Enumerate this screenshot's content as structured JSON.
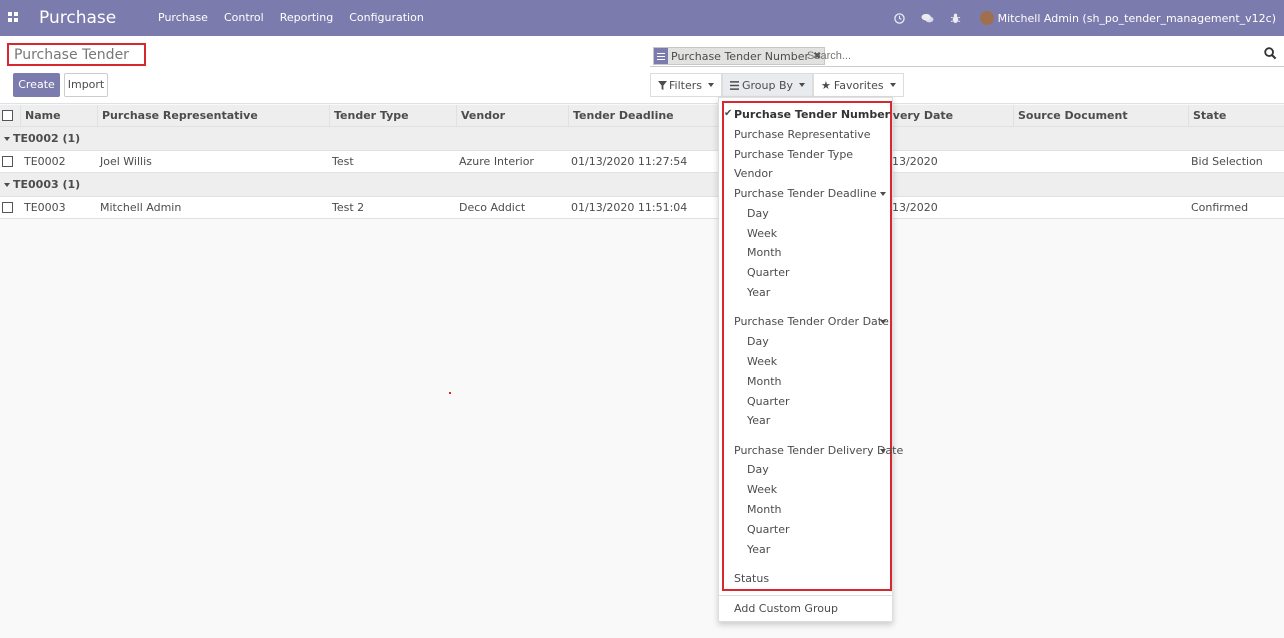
{
  "navbar": {
    "brand": "Purchase",
    "menu": [
      "Purchase",
      "Control",
      "Reporting",
      "Configuration"
    ],
    "user": "Mitchell Admin (sh_po_tender_management_v12c)",
    "icons": [
      "clock-icon",
      "chat-icon",
      "bug-icon"
    ]
  },
  "breadcrumb": "Purchase Tender",
  "buttons": {
    "create": "Create",
    "import": "Import"
  },
  "search": {
    "facet": "Purchase Tender Number",
    "placeholder": "Search..."
  },
  "filters": {
    "filters": "Filters",
    "group_by": "Group By",
    "favorites": "Favorites"
  },
  "table": {
    "columns": [
      "Name",
      "Purchase Representative",
      "Tender Type",
      "Vendor",
      "Tender Deadline",
      "ivery Date",
      "Source Document",
      "State"
    ],
    "groups": [
      {
        "label": "TE0002 (1)",
        "rows": [
          {
            "name": "TE0002",
            "rep": "Joel Willis",
            "type": "Test",
            "vendor": "Azure Interior",
            "deadline": "01/13/2020 11:27:54",
            "delivery": "13/2020",
            "source": "",
            "state": "Bid Selection"
          }
        ]
      },
      {
        "label": "TE0003 (1)",
        "rows": [
          {
            "name": "TE0003",
            "rep": "Mitchell Admin",
            "type": "Test 2",
            "vendor": "Deco Addict",
            "deadline": "01/13/2020 11:51:04",
            "delivery": "13/2020",
            "source": "",
            "state": "Confirmed"
          }
        ]
      }
    ]
  },
  "groupby_menu": {
    "items": [
      {
        "label": "Purchase Tender Number",
        "checked": true
      },
      {
        "label": "Purchase Representative"
      },
      {
        "label": "Purchase Tender Type"
      },
      {
        "label": "Vendor"
      },
      {
        "label": "Purchase Tender Deadline",
        "expandable": true
      },
      {
        "label": "Day",
        "sub": true
      },
      {
        "label": "Week",
        "sub": true
      },
      {
        "label": "Month",
        "sub": true
      },
      {
        "label": "Quarter",
        "sub": true
      },
      {
        "label": "Year",
        "sub": true
      },
      {
        "label": "Purchase Tender Order Date",
        "expandable": true
      },
      {
        "label": "Day",
        "sub": true
      },
      {
        "label": "Week",
        "sub": true
      },
      {
        "label": "Month",
        "sub": true
      },
      {
        "label": "Quarter",
        "sub": true
      },
      {
        "label": "Year",
        "sub": true
      },
      {
        "label": "Purchase Tender Delivery Date",
        "expandable": true
      },
      {
        "label": "Day",
        "sub": true
      },
      {
        "label": "Week",
        "sub": true
      },
      {
        "label": "Month",
        "sub": true
      },
      {
        "label": "Quarter",
        "sub": true
      },
      {
        "label": "Year",
        "sub": true
      },
      {
        "label": "Status"
      }
    ],
    "add_custom": "Add Custom Group"
  },
  "colors": {
    "brand": "#7c7bad",
    "highlight": "#d7282f"
  }
}
